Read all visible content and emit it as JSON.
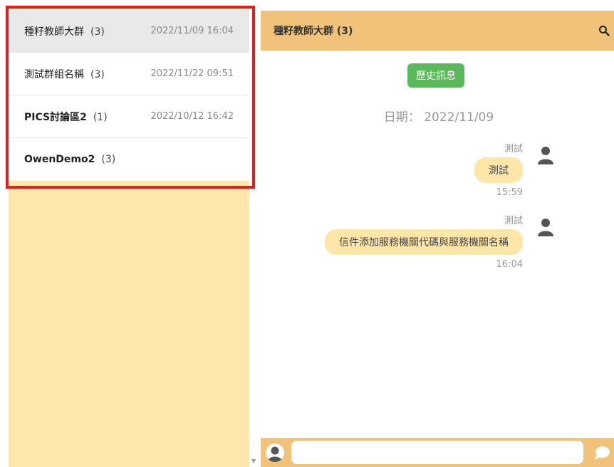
{
  "groups": [
    {
      "name": "種籽教師大群",
      "count": "(3)",
      "time": "2022/11/09 16:04",
      "bold": false
    },
    {
      "name": "測試群組名稱",
      "count": "(3)",
      "time": "2022/11/22 09:51",
      "bold": false
    },
    {
      "name": "PICS討論區2",
      "count": "(1)",
      "time": "2022/10/12 16:42",
      "bold": true
    },
    {
      "name": "OwenDemo2",
      "count": "(3)",
      "time": "",
      "bold": true
    }
  ],
  "chat": {
    "title": "種籽教師大群 (3)",
    "history_button": "歷史訊息",
    "date_label": "日期： 2022/11/09",
    "messages": [
      {
        "sender": "測試",
        "text": "測試",
        "time": "15:59"
      },
      {
        "sender": "測試",
        "text": "信件添加服務機關代碼與服務機關名稱",
        "time": "16:04"
      }
    ],
    "input_placeholder": ""
  },
  "icons": {
    "search": "search-icon",
    "avatar": "user-avatar-icon",
    "send": "chat-bubble-send-icon",
    "scroll": "scroll-down-arrow-icon"
  },
  "colors": {
    "sidebar_bg": "#ffe6ab",
    "header_bg": "#f0c27a",
    "history_button": "#5cb85c",
    "bubble": "#fde6a8",
    "highlight": "#e02020"
  }
}
